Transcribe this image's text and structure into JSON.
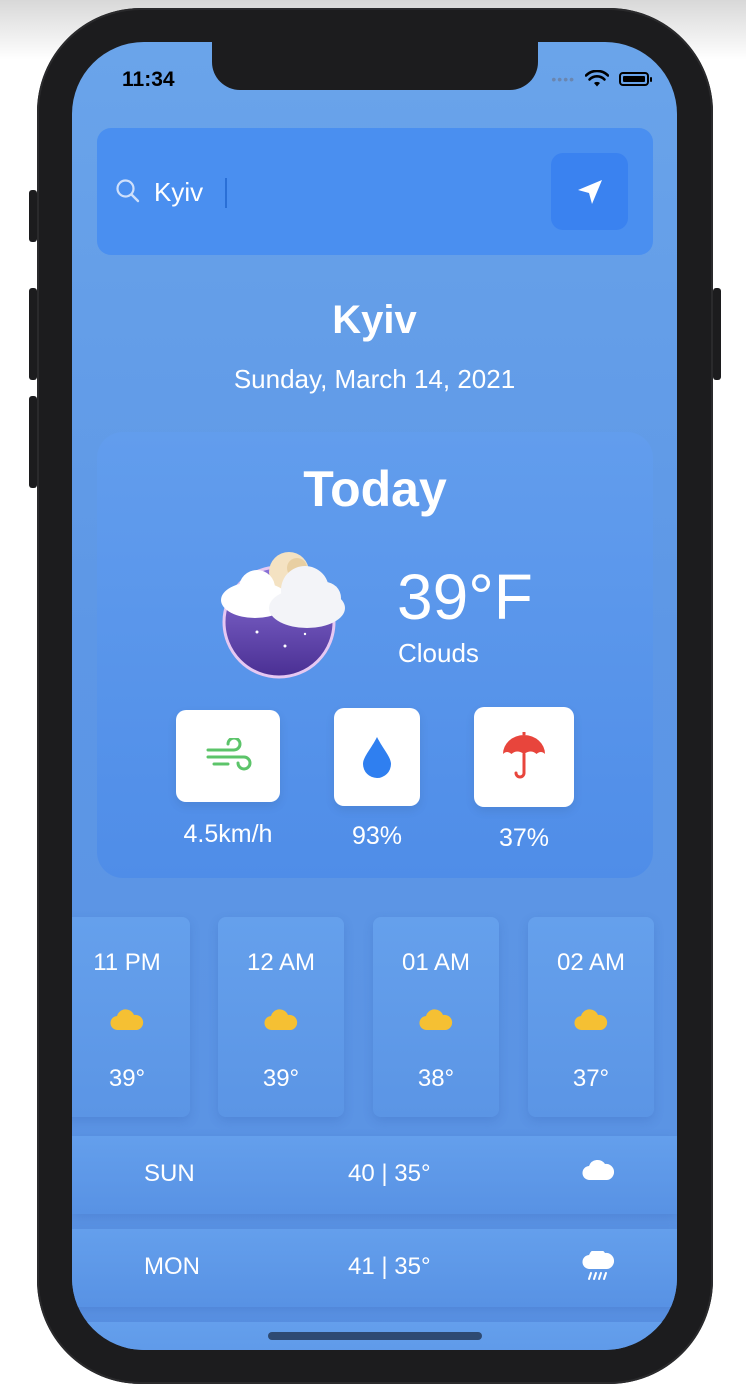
{
  "status": {
    "time": "11:34"
  },
  "search": {
    "value": "Kyiv",
    "placeholder": ""
  },
  "location": {
    "city": "Kyiv",
    "date": "Sunday, March 14, 2021"
  },
  "today": {
    "title": "Today",
    "temperature": "39°F",
    "condition": "Clouds",
    "icon": "night-clouds-icon",
    "stats": [
      {
        "icon": "wind-icon",
        "value": "4.5km/h"
      },
      {
        "icon": "humidity-drop-icon",
        "value": "93%"
      },
      {
        "icon": "umbrella-icon",
        "value": "37%"
      }
    ]
  },
  "hourly": [
    {
      "time": "11 PM",
      "icon": "cloud-icon",
      "temp": "39°"
    },
    {
      "time": "12 AM",
      "icon": "cloud-icon",
      "temp": "39°"
    },
    {
      "time": "01 AM",
      "icon": "cloud-icon",
      "temp": "38°"
    },
    {
      "time": "02 AM",
      "icon": "cloud-icon",
      "temp": "37°"
    }
  ],
  "daily": [
    {
      "day": "SUN",
      "temps": "40 | 35°",
      "icon": "cloud-icon"
    },
    {
      "day": "MON",
      "temps": "41 | 35°",
      "icon": "rain-cloud-icon"
    }
  ],
  "colors": {
    "accent": "#3a82f0",
    "background": "#5d97e6",
    "sun": "#f5c033",
    "umbrella": "#e8453c",
    "wind": "#5cc46a",
    "drop": "#2f7ff0"
  }
}
